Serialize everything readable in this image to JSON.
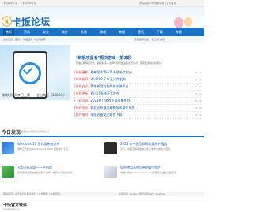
{
  "topbar": {
    "links": [
      "手机软件下载",
      "手机ASE下载"
    ],
    "right": "友情链接 | QQ在线客服 | 设为首页"
  },
  "header": {
    "logo_text": "卡饭论坛",
    "logo_url": "kafan.cn"
  },
  "nav": {
    "items": [
      "首页",
      "资讯",
      "安全",
      "软件",
      "系统",
      "游戏",
      "教程",
      "壁纸",
      "下载",
      "专题"
    ]
  },
  "subnav": {
    "left": "当前位置：首页 > 网络应用 > 热门推荐",
    "right": "专题推荐关注：今日热门资讯"
  },
  "hero": {
    "caption": "微软时间同步已上线——全山海区（1806年）"
  },
  "feature": {
    "title": "\"韩枫攻星者\"再次游戏（第2期）",
    "desc": "随着互联网的普及，越来越多人选择使用智能设备浏览资讯，获取更多信息和服务。"
  },
  "news": [
    {
      "cat": "[系统更新]",
      "title": "最新版本Win11系统补丁发布",
      "date": "04-12"
    },
    {
      "cat": "[软件推荐]",
      "title": "WinRAR 7.0 正式版发布",
      "date": "04-12"
    },
    {
      "cat": "[网络安全]",
      "title": "警惕新型钓鱼邮件诈骗手法",
      "date": "04-11"
    },
    {
      "cat": "[系统更新]",
      "title": "Win11系统正式发布",
      "date": "04-11"
    },
    {
      "cat": "[下载资源]",
      "title": "2023热门游戏下载合集推荐",
      "date": "04-10"
    },
    {
      "cat": "[新闻资讯]",
      "title": "微软宣布推出最新版本操作系统",
      "date": "04-10"
    },
    {
      "cat": "[软件推荐]",
      "title": "电脑必备安全软件下载",
      "date": "04-09"
    }
  ],
  "section": {
    "title": "今日发现",
    "subtitle": "更多精彩内容尽在卡饭论坛"
  },
  "cards": [
    {
      "title": "Windows 11 正式版系统发布",
      "desc": "微软正式推出Windows 11 2025 更新版本下载。"
    },
    {
      "title": "2025 年中国互联网发展统计报告",
      "desc": "近日，中国互联网络信息中心发布最新统计报告。"
    },
    {
      "title": "卡饭论坛网站——手机版",
      "desc": "随时随地浏览卡饭论坛精彩内容，支持多种设备访问。"
    },
    {
      "title": "如何使用系统自带的安全软件",
      "desc": "详细介绍Windows Defender的使用方法和设置技巧。"
    }
  ],
  "footer": {
    "left": "网站首页 | 关于我们 | 联系我们 | 广告服务 | 免责声明",
    "right": "友情链接: Twitter, 腾讯新闻 LIFE, Beehive"
  },
  "bottom": {
    "logo": "卡饭官方软件",
    "sub": "www.kafan.cn"
  },
  "colors": {
    "nav_bg": "#1a72c4",
    "accent": "#1a5faa",
    "category": "#d9534f"
  }
}
